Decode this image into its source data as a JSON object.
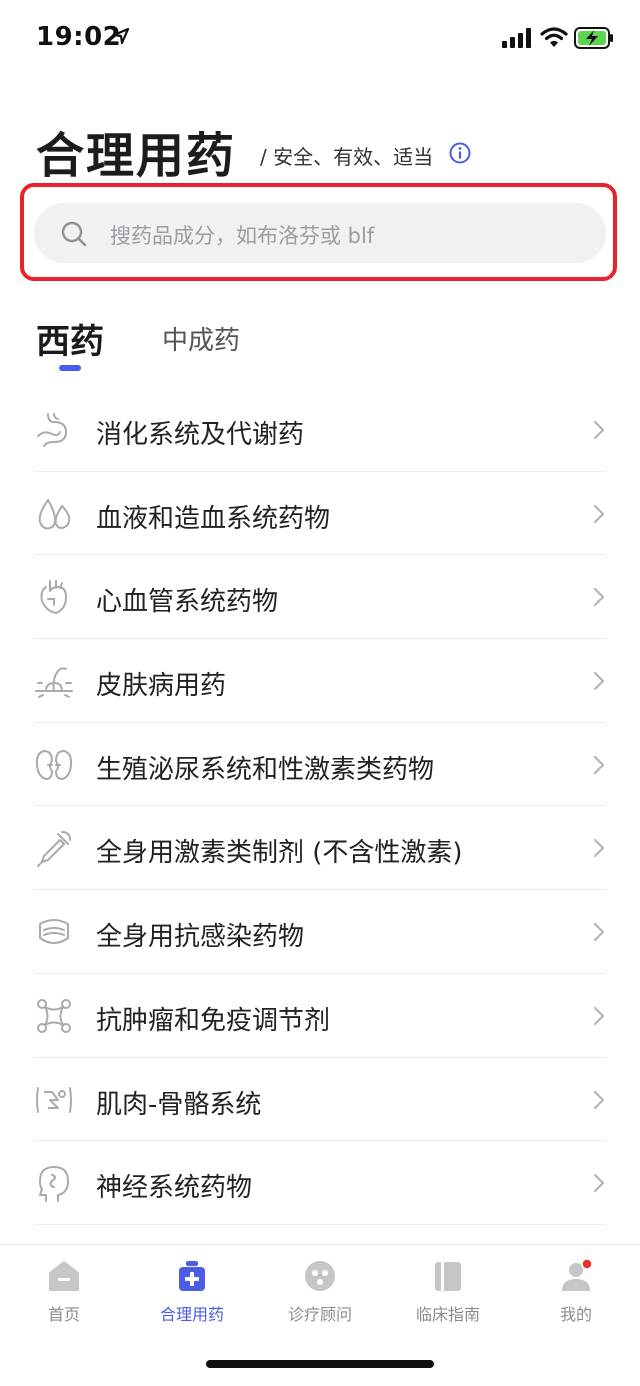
{
  "status_bar": {
    "time": "19:02"
  },
  "header": {
    "title": "合理用药",
    "subtitle": "/ 安全、有效、适当"
  },
  "search": {
    "placeholder": "搜药品成分，如布洛芬或 blf"
  },
  "tabs": [
    {
      "label": "西药",
      "active": true
    },
    {
      "label": "中成药",
      "active": false
    }
  ],
  "categories": [
    {
      "label": "消化系统及代谢药",
      "icon": "stomach-icon"
    },
    {
      "label": "血液和造血系统药物",
      "icon": "blood-drops-icon"
    },
    {
      "label": "心血管系统药物",
      "icon": "heart-icon"
    },
    {
      "label": "皮肤病用药",
      "icon": "skin-hair-icon"
    },
    {
      "label": "生殖泌尿系统和性激素类药物",
      "icon": "kidney-icon"
    },
    {
      "label": "全身用激素类制剂 (不含性激素)",
      "icon": "dropper-icon"
    },
    {
      "label": "全身用抗感染药物",
      "icon": "mask-icon"
    },
    {
      "label": "抗肿瘤和免疫调节剂",
      "icon": "molecule-icon"
    },
    {
      "label": "肌肉-骨骼系统",
      "icon": "bone-icon"
    },
    {
      "label": "神经系统药物",
      "icon": "head-nerve-icon"
    }
  ],
  "tab_bar": [
    {
      "label": "首页",
      "icon": "home-icon",
      "active": false
    },
    {
      "label": "合理用药",
      "icon": "medicine-kit-icon",
      "active": true
    },
    {
      "label": "诊疗顾问",
      "icon": "consultant-icon",
      "active": false
    },
    {
      "label": "临床指南",
      "icon": "guide-book-icon",
      "active": false
    },
    {
      "label": "我的",
      "icon": "profile-icon",
      "active": false,
      "badge": true
    }
  ],
  "colors": {
    "accent": "#4b5ce6",
    "highlight_border": "#e8232a",
    "search_bg": "#f0f1f3",
    "icon_gray": "#a8abb0",
    "badge_red": "#e8332a"
  }
}
